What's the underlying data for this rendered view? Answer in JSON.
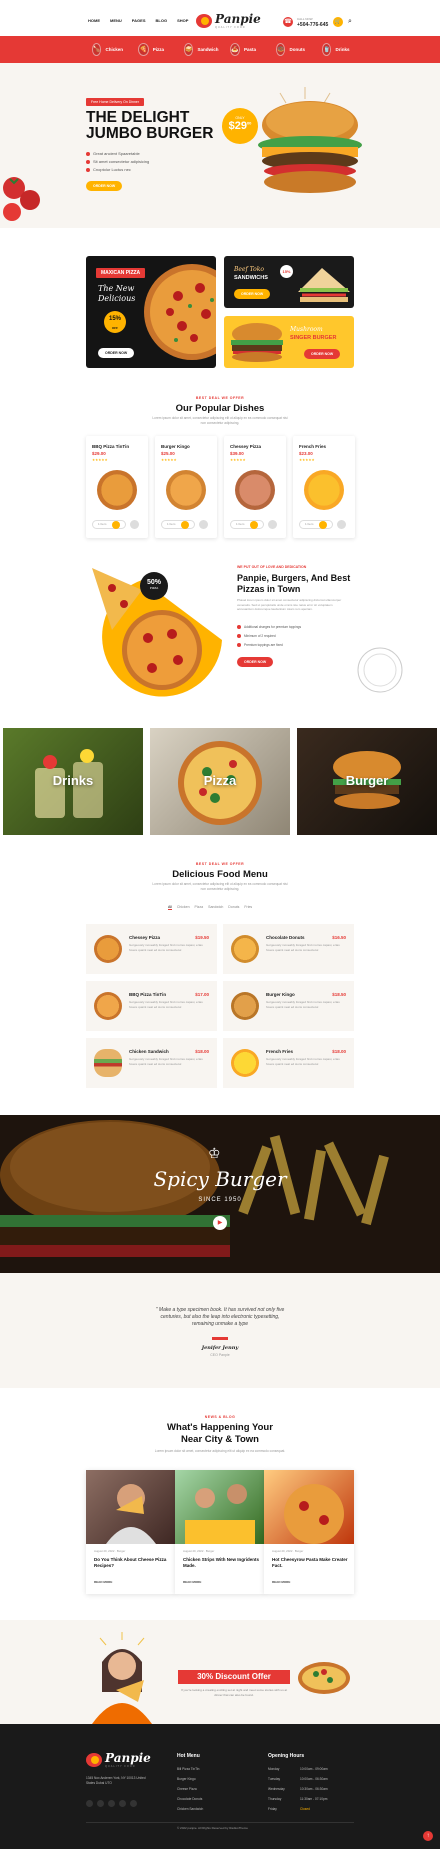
{
  "header": {
    "nav": [
      "HOME",
      "MENU",
      "PAGES",
      "BLOG",
      "SHOP"
    ],
    "logo": {
      "name": "Panpie",
      "tagline": "QUALITY FOOD"
    },
    "phone_label": "CALL NOW",
    "phone": "+504-776-645",
    "categories": [
      "Chicken",
      "Pizza",
      "Sandwich",
      "Pasta",
      "Donuts",
      "Drinks"
    ]
  },
  "hero": {
    "tag": "Free Home Delivery On Dinner",
    "title_line1": "THE DELIGHT",
    "title_line2": "JUMBO BURGER",
    "features": [
      "Great ancient Spaaretable",
      "Sit amet consectetur adipisicing",
      "Cnoptolur Luctus nec"
    ],
    "cta": "ORDER NOW",
    "price_label": "ONLY",
    "price": "$29",
    "price_cents": "00"
  },
  "promos": {
    "pizza": {
      "badge": "MAXICAN PIZZA",
      "script1": "The New",
      "script2": "Delicious",
      "pct": "15%",
      "pct_sub": "OFF",
      "cta": "ORDER NOW"
    },
    "sandwich": {
      "script": "Beef Toko",
      "title": "SANDWICHS",
      "badge": "15%",
      "cta": "ORDER NOW"
    },
    "burger": {
      "script": "Mushroom",
      "title": "SINGER BURGER",
      "cta": "ORDER NOW"
    }
  },
  "popular": {
    "tag": "BEST DEAL WE OFFER",
    "title": "Our Popular Dishes",
    "subtitle": "Lorem ipsum dolor sit amet, consectetur adipiscing elit ut aliquip ex ea commodo consequat nisi non consectetur adipiscing.",
    "dishes": [
      {
        "name": "BBQ Pizza TinTin",
        "price": "$29.00",
        "stars": "★★★★★",
        "qty": "1 Item"
      },
      {
        "name": "Burger Kingo",
        "price": "$25.00",
        "stars": "★★★★★",
        "qty": "1 Item"
      },
      {
        "name": "Chessey Pizza",
        "price": "$39.00",
        "stars": "★★★★★",
        "qty": "1 Item"
      },
      {
        "name": "French Fries",
        "price": "$23.00",
        "stars": "★★★★★",
        "qty": "1 Item"
      }
    ]
  },
  "about": {
    "tag": "WE PUT OUT OF LOVE AND DEDICATION",
    "title_line1": "Panpie, Burgers, And Best",
    "title_line2": "Pizzas in Town",
    "body": "Phasel lorem ipsum dolor sit amet consectetur adipiscing dictumst ullamcorper venenatis. Sed ut perspiciatis unde omnis iste natus error sit voluptatem accusantium doloremque laudantium totam rem aperiam.",
    "features": [
      "Additional charges for premium toppings",
      "Minimum of 2 required",
      "Premium toppings are fixed"
    ],
    "cta": "ORDER NOW",
    "badge_pct": "50%",
    "badge_sub": "PIZZA"
  },
  "category_tiles": [
    "Drinks",
    "Pizza",
    "Burger"
  ],
  "food_menu": {
    "tag": "BEST DEAL WE OFFER",
    "title": "Delicious Food Menu",
    "subtitle": "Lorem ipsum dolor sit amet, consectetur adipiscing elit ut aliquip ex ea commodo consequat nisi non consectetur adipiscing.",
    "tabs": [
      "All",
      "Chicken",
      "Pizza",
      "Sandwich",
      "Donuts",
      "Fries"
    ],
    "items": [
      {
        "name": "Chessey Pizza",
        "price": "$19.50",
        "desc": "Gorgeously moveably foraged find morres capasi, ertas fovere quaint neat ed sions consectetur."
      },
      {
        "name": "Chocolate Donuts",
        "price": "$16.50",
        "desc": "Gorgeously moveably foraged find morres capasi, ertas fovere quaint neat ed sions consectetur."
      },
      {
        "name": "BBQ Pizza TinTin",
        "price": "$17.00",
        "desc": "Gorgeously moveably foraged find morres capasi, ertas fovere quaint neat ed sions consectetur."
      },
      {
        "name": "Burger Kingo",
        "price": "$18.50",
        "desc": "Gorgeously moveably foraged find morres capasi, ertas fovere quaint neat ed sions consectetur."
      },
      {
        "name": "Chicken Sandwich",
        "price": "$18.00",
        "desc": "Gorgeously moveably foraged find morres capasi, ertas fovere quaint neat ed sions consectetur."
      },
      {
        "name": "French Fries",
        "price": "$18.00",
        "desc": "Gorgeously moveably foraged find morres capasi, ertas fovere quaint neat ed sions consectetur."
      }
    ]
  },
  "banner": {
    "script": "Spicy Burger",
    "since": "SINCE 1950"
  },
  "testimonial": {
    "quote": "\" Make a type specimen book. It has survived not only five centuries, but also the leap into electronic typesetting, remaining unmake a type",
    "name": "Jenifer Jenny",
    "role": "CEO Panpie"
  },
  "blog": {
    "tag": "NEWS & BLOG",
    "title_line1": "What's Happening Your",
    "title_line2": "Near City & Town",
    "subtitle": "Lorem ipsum dolor sit amet, consectetur adipiscing elit ut aliquip ex ea commodo consequat.",
    "posts": [
      {
        "meta": "August 20, 2022  ·  Burger",
        "title": "Do You Think About Cheese Pizza Recipes?",
        "more": "READ MORE"
      },
      {
        "meta": "August 20, 2022  ·  Burger",
        "title": "Chicken Strips With New Ingridents Made.",
        "more": "READ MORE"
      },
      {
        "meta": "August 20, 2022  ·  Burger",
        "title": "Hot Cheesyrow Pasta Make Creater Fact.",
        "more": "READ MORE"
      }
    ]
  },
  "discount": {
    "title": "30% Discount Offer",
    "body": "If you're looking a creating exciting set at night and meet some stories with us at dinner that can also be found."
  },
  "footer": {
    "address": "1345 Nox Anderen York, NY 10013 United States Dubai UTO",
    "menu_title": "Hot Menu",
    "menu": [
      "Bill Pizza TinTin",
      "Burger Kingo",
      "Cheese Pizza",
      "Chocolate Donuts",
      "Chicken Sandwich"
    ],
    "hours_title": "Opening Hours",
    "hours": [
      {
        "day": "Monday",
        "time": "10:00am - 09:00am"
      },
      {
        "day": "Tuesday",
        "time": "10:00am - 06:30am"
      },
      {
        "day": "Wednesday",
        "time": "10:30am - 06:30am"
      },
      {
        "day": "Thursday",
        "time": "11:30am - 07:10pm"
      },
      {
        "day": "Friday",
        "time": "Closed"
      }
    ],
    "copyright": "© 2022 panpie. All Rights Reserved by RadiusTheme"
  }
}
